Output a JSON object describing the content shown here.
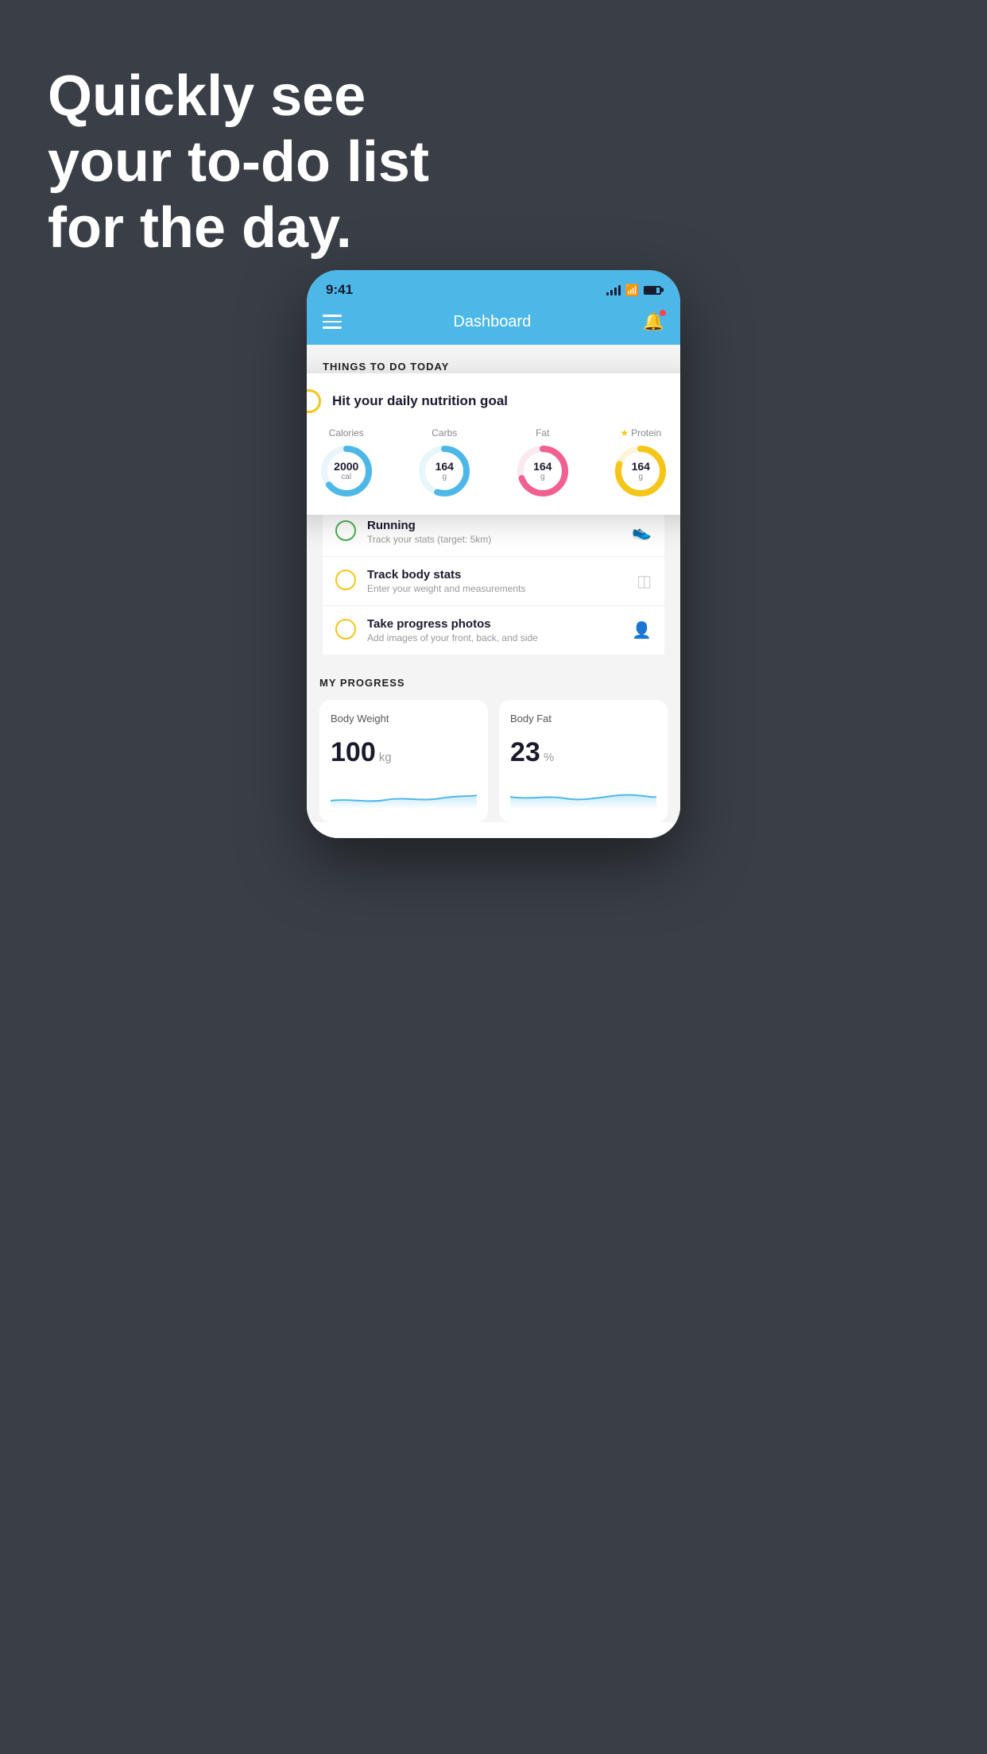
{
  "hero": {
    "line1": "Quickly see",
    "line2": "your to-do list",
    "line3": "for the day."
  },
  "statusBar": {
    "time": "9:41"
  },
  "navBar": {
    "title": "Dashboard"
  },
  "thingsToDo": {
    "sectionLabel": "THINGS TO DO TODAY",
    "card": {
      "title": "Hit your daily nutrition goal",
      "nutrition": [
        {
          "label": "Calories",
          "value": "2000",
          "unit": "cal",
          "color": "#4db8e8",
          "percent": 65,
          "star": false
        },
        {
          "label": "Carbs",
          "value": "164",
          "unit": "g",
          "color": "#4db8e8",
          "percent": 55,
          "star": false
        },
        {
          "label": "Fat",
          "value": "164",
          "unit": "g",
          "color": "#f06090",
          "percent": 70,
          "star": false
        },
        {
          "label": "Protein",
          "value": "164",
          "unit": "g",
          "color": "#f5c518",
          "percent": 80,
          "star": true
        }
      ]
    },
    "items": [
      {
        "title": "Running",
        "subtitle": "Track your stats (target: 5km)",
        "circleColor": "green",
        "icon": "shoe"
      },
      {
        "title": "Track body stats",
        "subtitle": "Enter your weight and measurements",
        "circleColor": "yellow",
        "icon": "scale"
      },
      {
        "title": "Take progress photos",
        "subtitle": "Add images of your front, back, and side",
        "circleColor": "yellow",
        "icon": "person"
      }
    ]
  },
  "progress": {
    "sectionLabel": "MY PROGRESS",
    "cards": [
      {
        "title": "Body Weight",
        "value": "100",
        "unit": "kg"
      },
      {
        "title": "Body Fat",
        "value": "23",
        "unit": "%"
      }
    ]
  }
}
